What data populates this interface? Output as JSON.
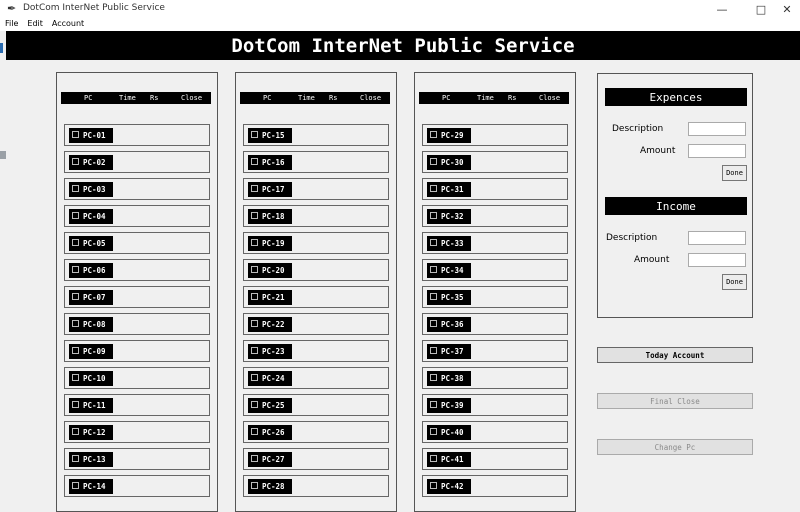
{
  "window": {
    "title": "DotCom InterNet Public Service",
    "feather_icon": "✒",
    "minimize_glyph": "—",
    "maximize_glyph": "□",
    "close_glyph": "✕"
  },
  "menu": [
    "File",
    "Edit",
    "Account"
  ],
  "banner": {
    "title": "DotCom InterNet Public Service"
  },
  "columns": {
    "headers": [
      "PC",
      "Time",
      "Rs",
      "Close"
    ]
  },
  "panels": [
    {
      "pcs": [
        "PC-01",
        "PC-02",
        "PC-03",
        "PC-04",
        "PC-05",
        "PC-06",
        "PC-07",
        "PC-08",
        "PC-09",
        "PC-10",
        "PC-11",
        "PC-12",
        "PC-13",
        "PC-14"
      ]
    },
    {
      "pcs": [
        "PC-15",
        "PC-16",
        "PC-17",
        "PC-18",
        "PC-19",
        "PC-20",
        "PC-21",
        "PC-22",
        "PC-23",
        "PC-24",
        "PC-25",
        "PC-26",
        "PC-27",
        "PC-28"
      ]
    },
    {
      "pcs": [
        "PC-29",
        "PC-30",
        "PC-31",
        "PC-32",
        "PC-33",
        "PC-34",
        "PC-35",
        "PC-36",
        "PC-37",
        "PC-38",
        "PC-39",
        "PC-40",
        "PC-41",
        "PC-42"
      ]
    }
  ],
  "expenses": {
    "title": "Expences",
    "description_label": "Description",
    "amount_label": "Amount",
    "description_value": "",
    "amount_value": "",
    "done_label": "Done"
  },
  "income": {
    "title": "Income",
    "description_label": "Description",
    "amount_label": "Amount",
    "description_value": "",
    "amount_value": "",
    "done_label": "Done"
  },
  "actions": {
    "today_account": "Today Account",
    "final_close": "Final Close",
    "change_pc": "Change Pc"
  }
}
